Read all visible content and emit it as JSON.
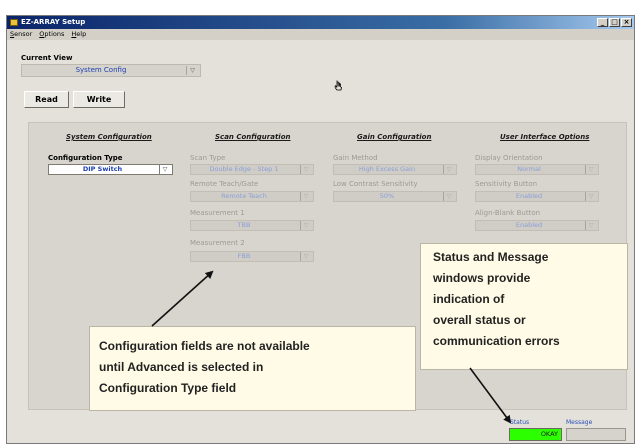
{
  "window": {
    "title": "EZ-ARRAY Setup",
    "controls": [
      "_",
      "□",
      "×"
    ]
  },
  "menubar": {
    "items": [
      "Sensor",
      "Options",
      "Help"
    ]
  },
  "current_view": {
    "label": "Current View",
    "value": "System Config"
  },
  "toolbar": {
    "read_label": "Read",
    "write_label": "Write"
  },
  "sections": {
    "system": {
      "heading": "System Configuration",
      "fields": [
        {
          "label": "Configuration Type",
          "value": "DIP Switch"
        }
      ]
    },
    "scan": {
      "heading": "Scan Configuration",
      "fields": [
        {
          "label": "Scan Type",
          "value": "Double Edge - Step 1"
        },
        {
          "label": "Remote Teach/Gate",
          "value": "Remote Teach"
        },
        {
          "label": "Measurement 1",
          "value": "TBB"
        },
        {
          "label": "Measurement 2",
          "value": "FBB"
        }
      ]
    },
    "gain": {
      "heading": "Gain Configuration",
      "fields": [
        {
          "label": "Gain Method",
          "value": "High Excess Gain"
        },
        {
          "label": "Low Contrast Sensitivity",
          "value": "50%"
        }
      ]
    },
    "ui": {
      "heading": "User Interface Options",
      "fields": [
        {
          "label": "Display Orientation",
          "value": "Normal"
        },
        {
          "label": "Sensitivity Button",
          "value": "Enabled"
        },
        {
          "label": "Align-Blank Button",
          "value": "Enabled"
        }
      ]
    }
  },
  "callouts": {
    "left": [
      "Configuration fields are not available",
      "until Advanced is selected in",
      "Configuration Type field"
    ],
    "right": [
      "Status and Message",
      "windows provide",
      "indication of",
      "overall status or",
      "communication errors"
    ]
  },
  "statusbar": {
    "status_label": "Status",
    "status_value": "OKAY",
    "status_color": "#2cff00",
    "message_label": "Message",
    "message_value": ""
  },
  "icons": [
    "app-icon",
    "chevron-down-icon",
    "hand-cursor-icon"
  ],
  "colors": {
    "titlebar": "#0a246a",
    "accent_text": "#1c3fb0",
    "callout_bg": "#fffbe6"
  }
}
